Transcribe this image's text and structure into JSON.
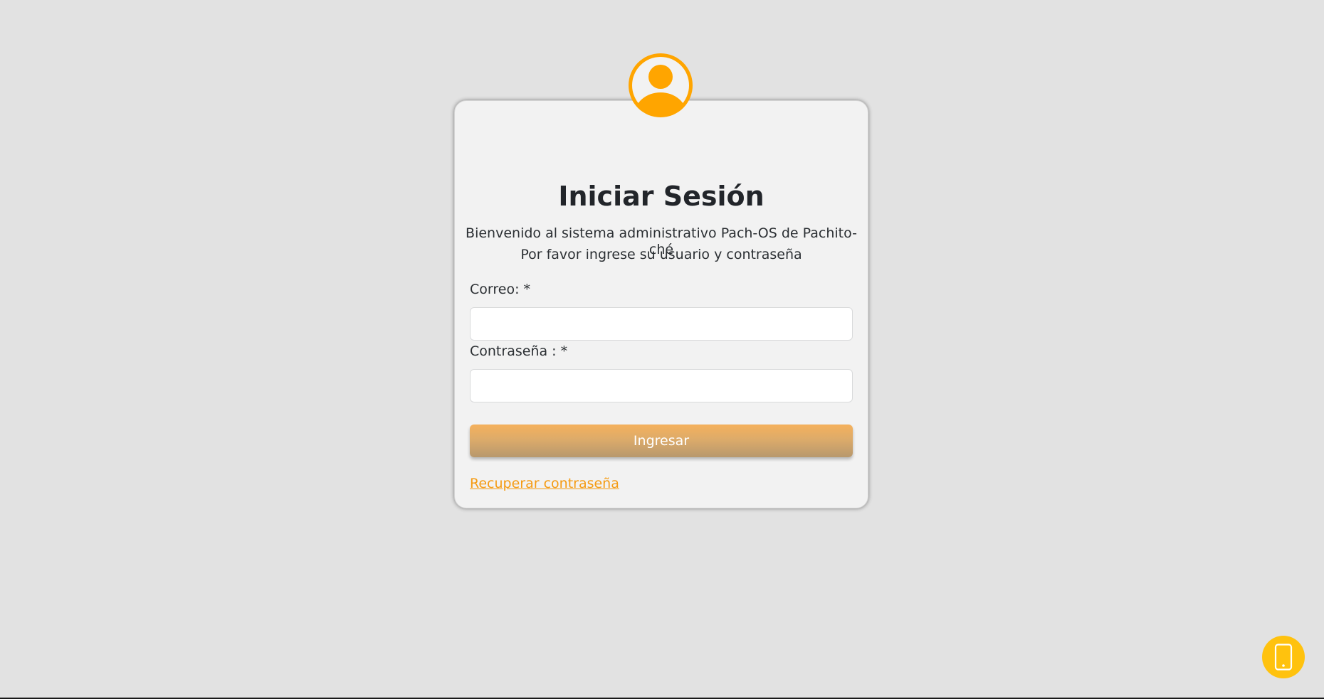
{
  "login": {
    "title": "Iniciar Sesión",
    "welcome_text": "Bienvenido al sistema administrativo Pach-OS de Pachito-ché",
    "prompt_text": "Por favor ingrese su usuario y contraseña",
    "email_label": "Correo: *",
    "email_value": "",
    "password_label": "Contraseña : *",
    "password_value": "",
    "submit_label": "Ingresar",
    "recover_link": "Recuperar contraseña"
  },
  "icons": {
    "avatar": "user-circle-icon",
    "mobile": "mobile-phone-icon"
  },
  "colors": {
    "background": "#e2e2e2",
    "accent": "#ffa500",
    "link": "#f59b12",
    "mobile_button": "#ffc20e"
  }
}
